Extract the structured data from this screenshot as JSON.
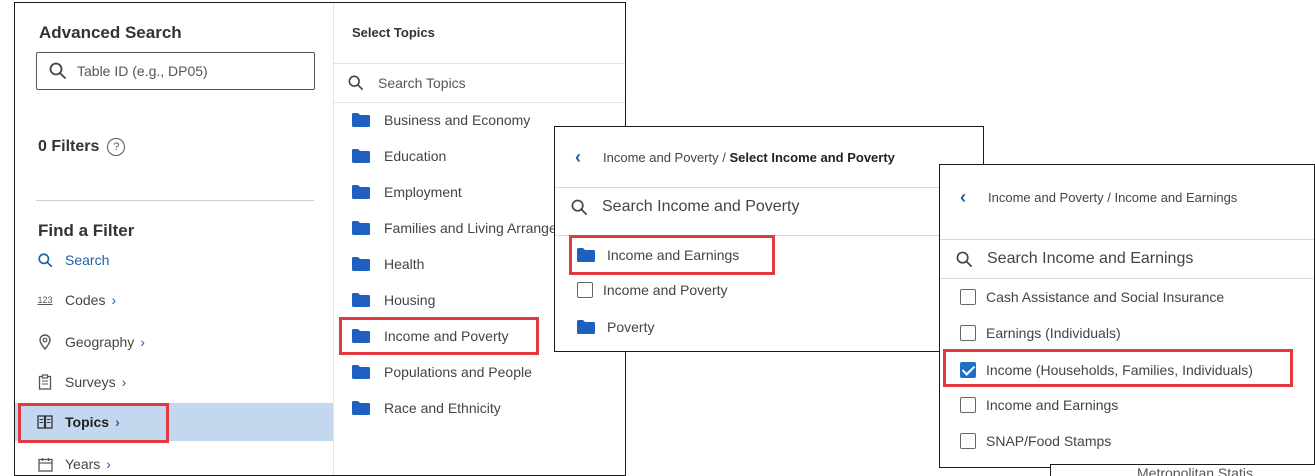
{
  "advanced_search": {
    "title": "Advanced Search",
    "search_placeholder": "Table ID (e.g., DP05)",
    "filters_label": "0 Filters",
    "help_icon_text": "?",
    "find_filter_title": "Find a Filter",
    "filters": [
      {
        "label": "Search",
        "icon": "search-icon",
        "has_chevron": false
      },
      {
        "label": "Codes",
        "icon": "codes-123-icon",
        "has_chevron": true
      },
      {
        "label": "Geography",
        "icon": "location-pin-icon",
        "has_chevron": true
      },
      {
        "label": "Surveys",
        "icon": "clipboard-icon",
        "has_chevron": true
      },
      {
        "label": "Topics",
        "icon": "book-icon",
        "has_chevron": true,
        "active": true
      },
      {
        "label": "Years",
        "icon": "calendar-icon",
        "has_chevron": true
      }
    ],
    "chevron": "›"
  },
  "select_topics": {
    "title": "Select Topics",
    "search_placeholder": "Search Topics",
    "topics": [
      "Business and Economy",
      "Education",
      "Employment",
      "Families and Living Arrangements",
      "Health",
      "Housing",
      "Income and Poverty",
      "Populations and People",
      "Race and Ethnicity"
    ]
  },
  "income_poverty_panel": {
    "breadcrumb_parent": "Income and Poverty / ",
    "breadcrumb_current": "Select Income and Poverty",
    "search_placeholder": "Search Income and Poverty",
    "items": [
      {
        "label": "Income and Earnings",
        "kind": "folder"
      },
      {
        "label": "Income and Poverty",
        "kind": "checkbox",
        "checked": false
      },
      {
        "label": "Poverty",
        "kind": "folder"
      }
    ]
  },
  "income_earnings_panel": {
    "breadcrumb": "Income and Poverty / Income and Earnings",
    "search_placeholder": "Search Income and Earnings",
    "items": [
      {
        "label": "Cash Assistance and Social Insurance",
        "checked": false
      },
      {
        "label": "Earnings (Individuals)",
        "checked": false
      },
      {
        "label": "Income (Households, Families, Individuals)",
        "checked": true
      },
      {
        "label": "Income and Earnings",
        "checked": false
      },
      {
        "label": "SNAP/Food Stamps",
        "checked": false
      }
    ]
  },
  "corner_text": "Metropolitan Statis",
  "colors": {
    "accent_blue": "#1f5fa8",
    "folder_blue": "#1f5fbf",
    "active_bg": "#c3d8ef",
    "highlight_red": "#e0393e",
    "checkbox_blue": "#1f6fc5"
  }
}
